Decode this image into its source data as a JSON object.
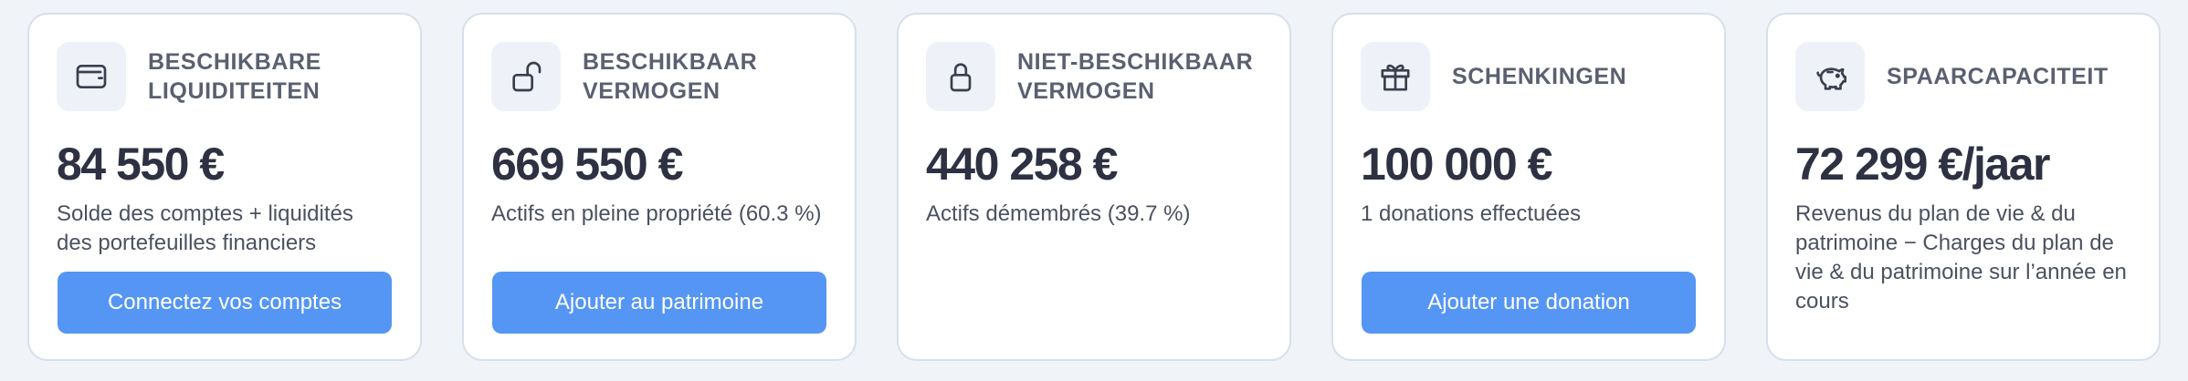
{
  "cards": [
    {
      "icon": "wallet-icon",
      "title_line1": "BESCHIKBARE",
      "title_line2": "LIQUIDITEITEN",
      "value": "84 550 €",
      "description": "Solde des comptes + liquidités des portefeuilles financiers",
      "button_label": "Connectez vos comptes"
    },
    {
      "icon": "unlocked-padlock-icon",
      "title_line1": "BESCHIKBAAR",
      "title_line2": "VERMOGEN",
      "value": "669 550 €",
      "description": "Actifs en pleine propriété (60.3 %)",
      "button_label": "Ajouter au patrimoine"
    },
    {
      "icon": "locked-padlock-icon",
      "title_line1": "NIET-BESCHIKBAAR",
      "title_line2": "VERMOGEN",
      "value": "440 258 €",
      "description": "Actifs démembrés (39.7 %)"
    },
    {
      "icon": "gift-icon",
      "title_line1": "SCHENKINGEN",
      "value": "100 000 €",
      "description": "1 donations effectuées",
      "button_label": "Ajouter une donation"
    },
    {
      "icon": "piggy-bank-icon",
      "title_line1": "SPAARCAPACITEIT",
      "value": "72 299 €/jaar",
      "description": "Revenus du plan de vie & du patrimoine − Charges du plan de vie & du patrimoine sur l’année en cours"
    }
  ],
  "colors": {
    "page_background": "#f0f3f7",
    "card_border": "#d7e0ea",
    "icon_background": "#eef2f8",
    "button": "#5596f4",
    "title": "#5b6070",
    "value": "#2d3142"
  }
}
